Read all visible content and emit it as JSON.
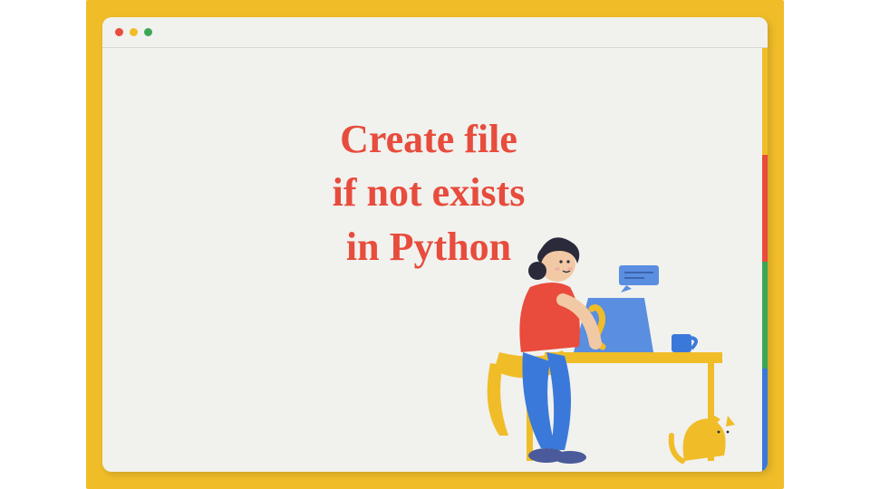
{
  "titlebar": {
    "dots": [
      "red",
      "yellow",
      "green"
    ]
  },
  "title": {
    "line1": "Create file",
    "line2": "if not exists",
    "line3": "in Python"
  },
  "stripes": [
    "yellow",
    "red",
    "green",
    "blue"
  ],
  "colors": {
    "frame": "#f0bd29",
    "window": "#f1f1ee",
    "title_text": "#e74c3c",
    "red": "#e94b3c",
    "yellow": "#f0bd29",
    "green": "#3aa757",
    "blue": "#3a79d9"
  },
  "illustration": {
    "description": "woman-at-desk-with-laptop-and-cat"
  }
}
